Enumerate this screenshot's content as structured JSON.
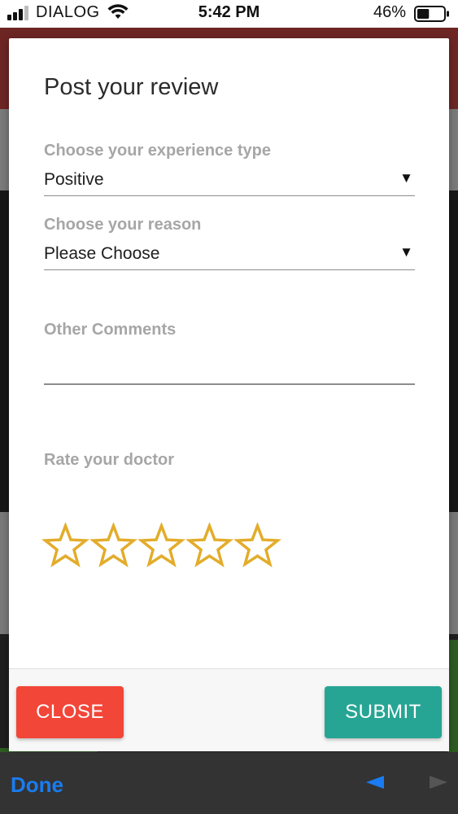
{
  "status_bar": {
    "carrier": "DIALOG",
    "time": "5:42 PM",
    "battery_percent": "46%",
    "battery_level": 0.46
  },
  "modal": {
    "title": "Post your review",
    "experience_type": {
      "label": "Choose your experience type",
      "value": "Positive"
    },
    "reason": {
      "label": "Choose your reason",
      "value": "Please Choose"
    },
    "comments": {
      "label": "Other Comments",
      "value": ""
    },
    "rating": {
      "label": "Rate your doctor",
      "max": 5,
      "value": 0,
      "star_color": "#e3ac2a"
    },
    "buttons": {
      "close_label": "CLOSE",
      "submit_label": "SUBMIT"
    }
  },
  "keyboard_bar": {
    "done_label": "Done"
  },
  "colors": {
    "close": "#f24638",
    "submit": "#27a594",
    "done": "#1a7cf0"
  }
}
